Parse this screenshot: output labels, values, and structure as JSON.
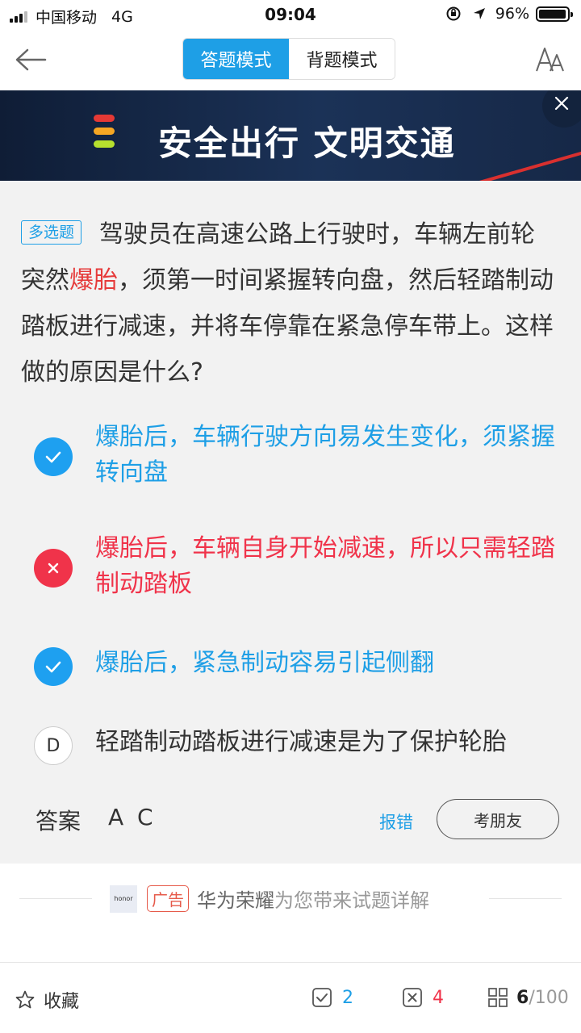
{
  "status_bar": {
    "carrier": "中国移动",
    "network": "4G",
    "time": "09:04",
    "battery": "96%",
    "battery_level": 0.96
  },
  "header": {
    "modes": [
      "答题模式",
      "背题模式"
    ],
    "active_mode": "答题模式",
    "icons": [
      "back-arrow-icon",
      "font-size-icon"
    ]
  },
  "banner": {
    "slogan": "安全出行 文明交通",
    "light_colors": [
      "#e53935",
      "#f5a623",
      "#b6e02e"
    ]
  },
  "question": {
    "type_tag": "多选题",
    "text_before": "驾驶员在高速公路上行驶时，车辆左前轮突然",
    "highlight": "爆胎",
    "text_after": "，须第一时间紧握转向盘，然后轻踏制动踏板进行减速，并将车停靠在紧急停车带上。这样做的原因是什么?"
  },
  "options": [
    {
      "mark": "check",
      "state": "correct",
      "text": "爆胎后，车辆行驶方向易发生变化，须紧握转向盘"
    },
    {
      "mark": "cross",
      "state": "wrong",
      "text": "爆胎后，车辆自身开始减速，所以只需轻踏制动踏板"
    },
    {
      "mark": "check",
      "state": "correct",
      "text": "爆胎后，紧急制动容易引起侧翻"
    },
    {
      "mark": "D",
      "state": "unselected",
      "text": "轻踏制动踏板进行减速是为了保护轮胎"
    }
  ],
  "answer": {
    "label": "答案",
    "value": "A C",
    "report": "报错",
    "ask_friend": "考朋友"
  },
  "ad": {
    "logo_text": "honor",
    "tag": "广告",
    "brand": "华为荣耀",
    "slogan": "为您带来试题详解"
  },
  "bottom_bar": {
    "favorite": "收藏",
    "correct_count": "2",
    "wrong_count": "4",
    "current": "6",
    "total": "/100"
  },
  "colors": {
    "accent": "#1e9fe6",
    "wrong": "#f0334a",
    "highlight": "#e63a3a"
  }
}
